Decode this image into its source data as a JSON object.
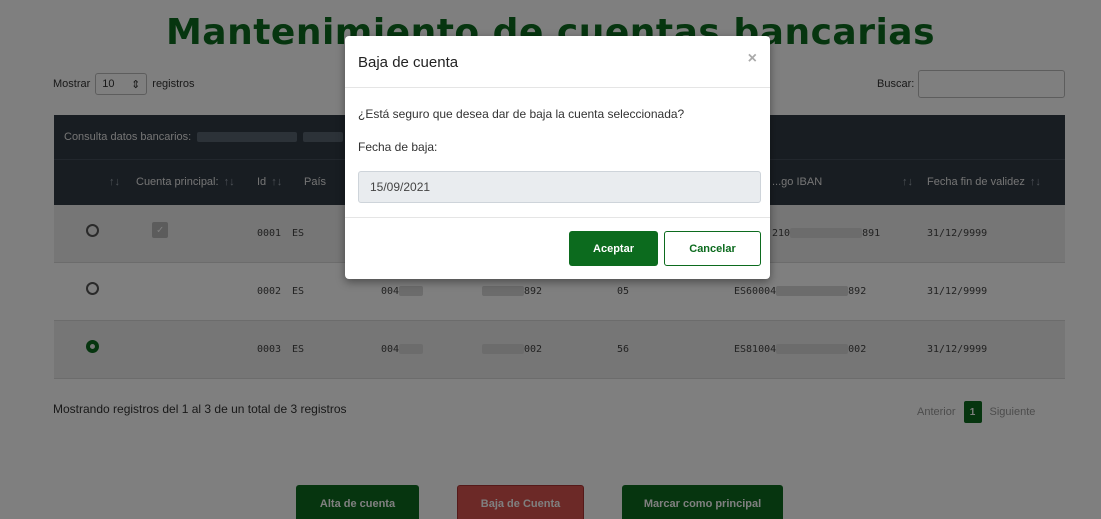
{
  "page": {
    "title": "Mantenimiento de cuentas bancarias",
    "length_prefix": "Mostrar",
    "length_value": "10",
    "length_suffix": "registros",
    "search_label": "Buscar:",
    "search_value": ""
  },
  "table": {
    "top_header": "Consulta datos bancarios:",
    "columns": [
      {
        "label": ""
      },
      {
        "label": "Cuenta principal:"
      },
      {
        "label": "Id"
      },
      {
        "label": "País"
      },
      {
        "label": "...go IBAN"
      },
      {
        "label": "Fecha fin de validez"
      }
    ],
    "rows": [
      {
        "selected": false,
        "principal": true,
        "id": "0001",
        "pais": "ES",
        "col3": "",
        "col4": "",
        "col5": "",
        "iban_start": "210",
        "iban_end": "891",
        "fecha": "31/12/9999"
      },
      {
        "selected": false,
        "principal": false,
        "id": "0002",
        "pais": "ES",
        "col3": "004",
        "col4": "892",
        "col5": "05",
        "iban_start": "ES60004",
        "iban_end": "892",
        "fecha": "31/12/9999"
      },
      {
        "selected": true,
        "principal": false,
        "id": "0003",
        "pais": "ES",
        "col3": "004",
        "col4": "002",
        "col5": "56",
        "iban_start": "ES81004",
        "iban_end": "002",
        "fecha": "31/12/9999"
      }
    ],
    "info": "Mostrando registros del 1 al 3 de un total de 3 registros",
    "pager": {
      "prev": "Anterior",
      "current": "1",
      "next": "Siguiente"
    }
  },
  "actions": {
    "alta": "Alta de cuenta",
    "baja": "Baja de Cuenta",
    "principal": "Marcar como principal"
  },
  "modal": {
    "title": "Baja de cuenta",
    "close": "×",
    "question": "¿Está seguro que desea dar de baja la cuenta seleccionada?",
    "date_label": "Fecha de baja:",
    "date_value": "15/09/2021",
    "accept": "Aceptar",
    "cancel": "Cancelar"
  },
  "colors": {
    "brand_green": "#0c6b1e",
    "header_dark": "#303a45",
    "danger": "#d9534f"
  }
}
